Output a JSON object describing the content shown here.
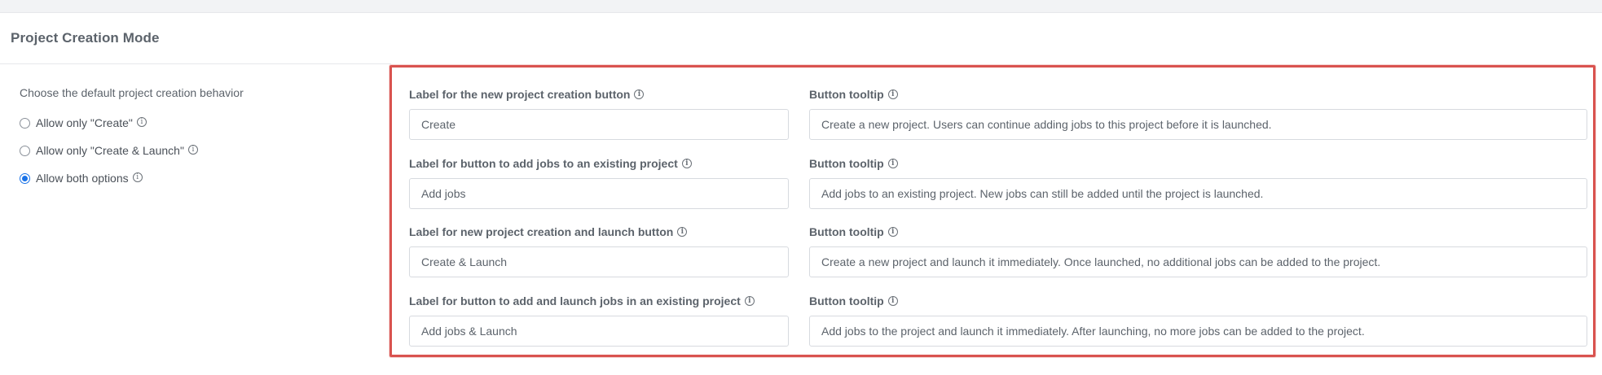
{
  "section": {
    "title": "Project Creation Mode"
  },
  "behavior": {
    "prompt": "Choose the default project creation behavior",
    "options": [
      {
        "label": "Allow only \"Create\"",
        "checked": false
      },
      {
        "label": "Allow only \"Create & Launch\"",
        "checked": false
      },
      {
        "label": "Allow both options",
        "checked": true
      }
    ]
  },
  "fields": [
    {
      "label": "Label for the new project creation button",
      "value": "Create",
      "tooltip_label": "Button tooltip",
      "tooltip_value": "Create a new project. Users can continue adding jobs to this project before it is launched."
    },
    {
      "label": "Label for button to add jobs to an existing project",
      "value": "Add jobs",
      "tooltip_label": "Button tooltip",
      "tooltip_value": "Add jobs to an existing project. New jobs can still be added until the project is launched."
    },
    {
      "label": "Label for new project creation and launch button",
      "value": "Create & Launch",
      "tooltip_label": "Button tooltip",
      "tooltip_value": "Create a new project and launch it immediately. Once launched, no additional jobs can be added to the project."
    },
    {
      "label": "Label for button to add and launch jobs in an existing project",
      "value": "Add jobs & Launch",
      "tooltip_label": "Button tooltip",
      "tooltip_value": "Add jobs to the project and launch it immediately. After launching, no more jobs can be added to the project."
    }
  ],
  "colors": {
    "accent": "#1a73e8",
    "highlight_border": "#d9534f"
  },
  "icons": {
    "info": "info-circle-icon"
  }
}
